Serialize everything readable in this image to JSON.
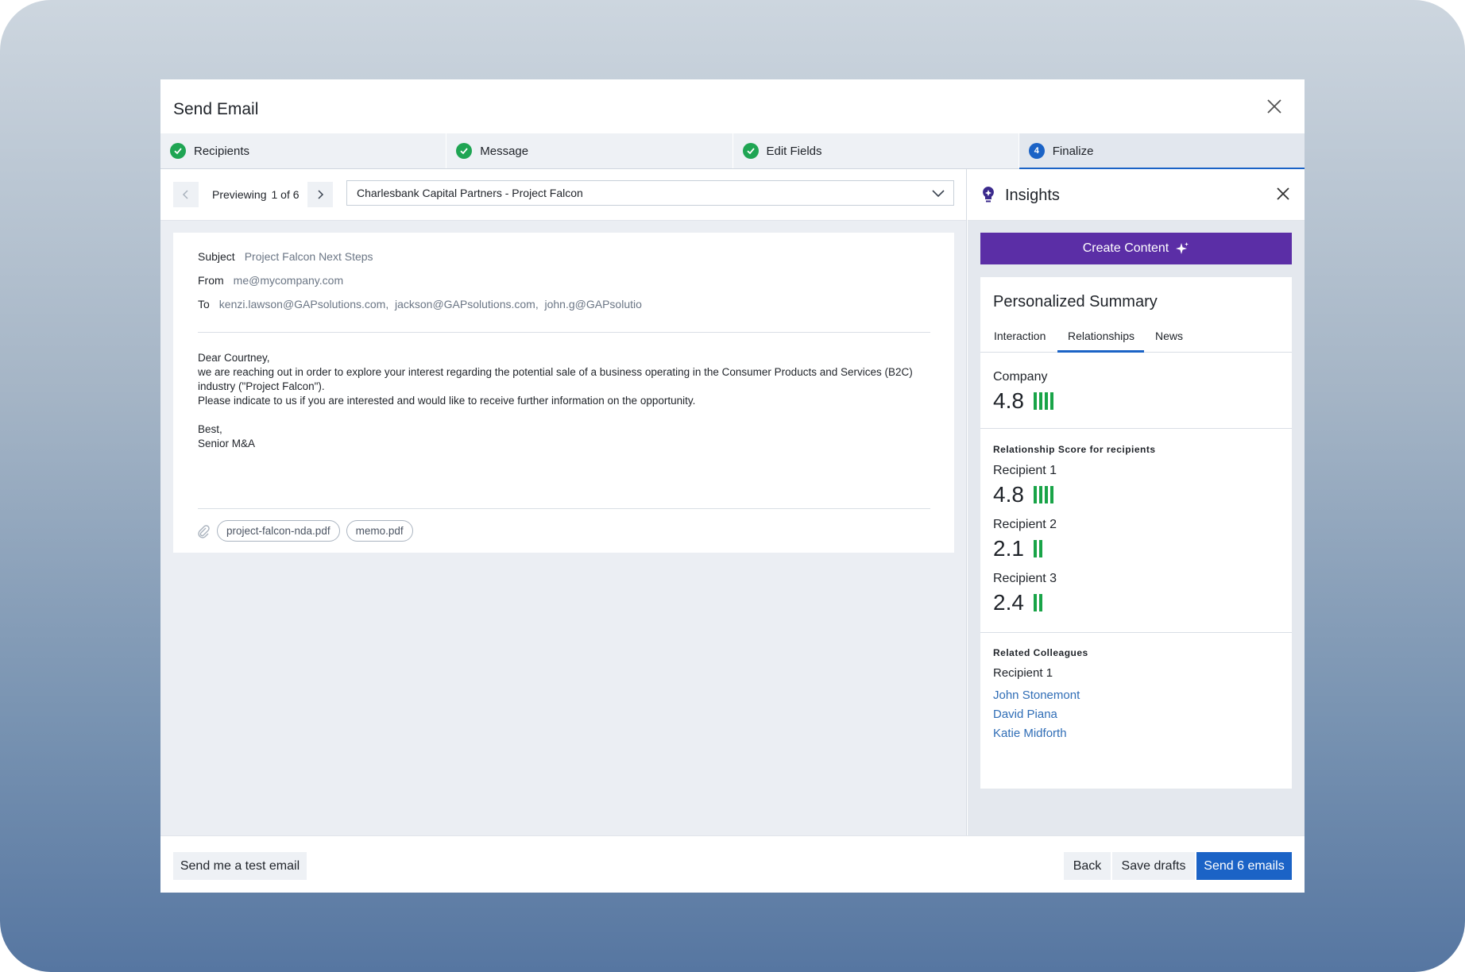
{
  "modal": {
    "title": "Send Email"
  },
  "steps": [
    {
      "label": "Recipients",
      "state": "done"
    },
    {
      "label": "Message",
      "state": "done"
    },
    {
      "label": "Edit Fields",
      "state": "done"
    },
    {
      "label": "Finalize",
      "state": "active",
      "number": "4"
    }
  ],
  "preview": {
    "label": "Previewing",
    "count": "1 of 6",
    "selected_recipient": "Charlesbank Capital Partners - Project Falcon"
  },
  "email": {
    "subject_label": "Subject",
    "subject": "Project Falcon Next Steps",
    "from_label": "From",
    "from": "me@mycompany.com",
    "to_label": "To",
    "to": "kenzi.lawson@GAPsolutions.com,  jackson@GAPsolutions.com,  john.g@GAPsolutio",
    "body": {
      "greeting": "Dear Courtney,",
      "line1": "we are reaching out in order to explore your interest regarding the potential sale of a business operating in the Consumer Products and Services (B2C) industry (\"Project Falcon\").",
      "line2": "Please indicate to us if you are interested and would like to receive further information on the opportunity.",
      "signoff": "Best,",
      "signature": "Senior M&A"
    },
    "attachments": [
      "project-falcon-nda.pdf",
      "memo.pdf"
    ]
  },
  "insights": {
    "title": "Insights",
    "create_button": "Create Content",
    "summary_title": "Personalized Summary",
    "tabs": [
      "Interaction",
      "Relationships",
      "News"
    ],
    "active_tab": "Relationships",
    "company": {
      "label": "Company",
      "score": "4.8",
      "bars": 4
    },
    "relationship_title": "Relationship Score for recipients",
    "recipients": [
      {
        "label": "Recipient 1",
        "score": "4.8",
        "bars": 4
      },
      {
        "label": "Recipient 2",
        "score": "2.1",
        "bars": 2
      },
      {
        "label": "Recipient 3",
        "score": "2.4",
        "bars": 2
      }
    ],
    "colleagues_title": "Related Colleagues",
    "colleagues_group": "Recipient 1",
    "colleagues": [
      "John Stonemont",
      "David Piana",
      "Katie Midforth"
    ]
  },
  "footer": {
    "test_email": "Send me a test email",
    "back": "Back",
    "save_drafts": "Save drafts",
    "send": "Send 6 emails"
  },
  "colors": {
    "accent": "#1b63c6",
    "create": "#5b2ea6",
    "success": "#1fa553",
    "score_bar": "#19a448",
    "link": "#2f6db6"
  }
}
